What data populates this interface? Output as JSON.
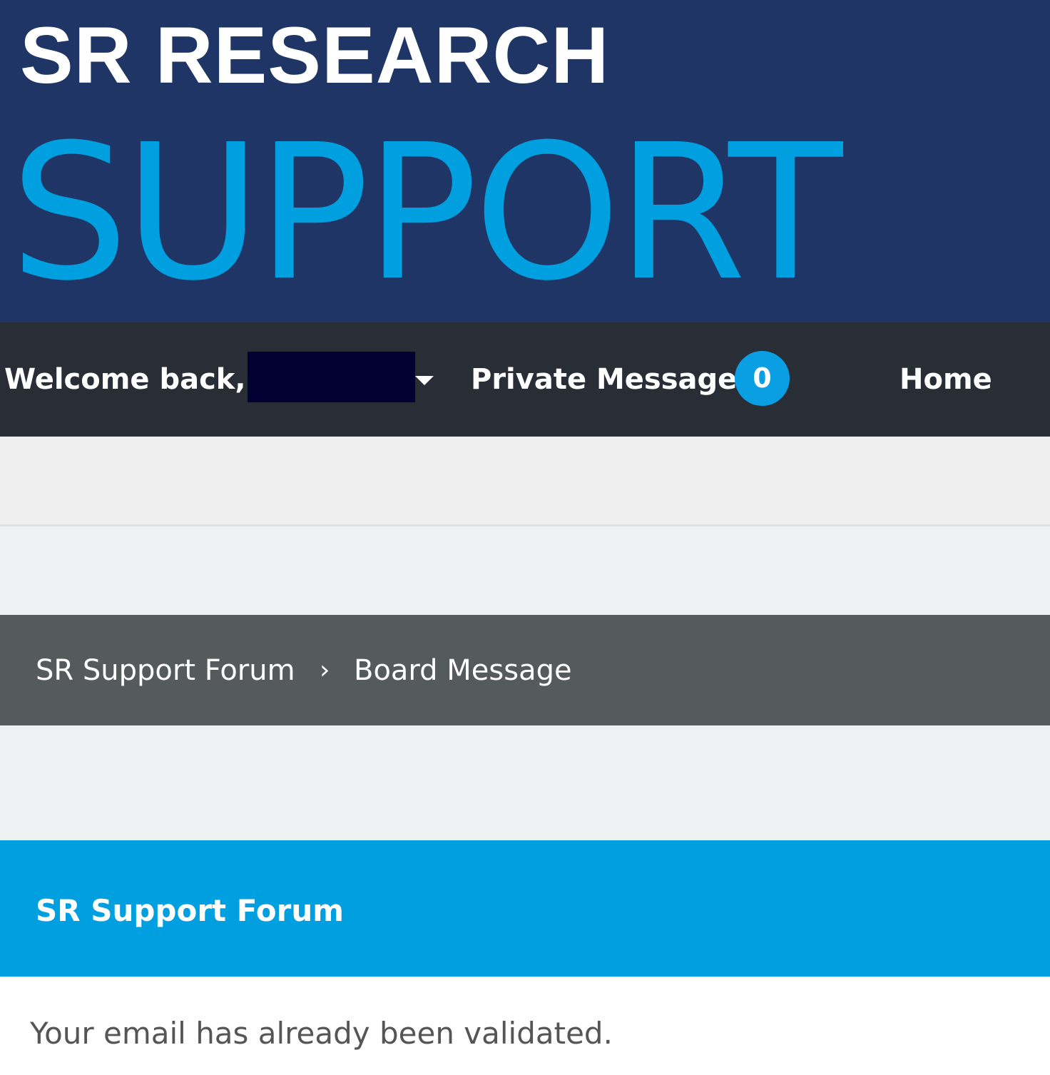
{
  "banner": {
    "logo_line1": "SR RESEARCH",
    "logo_line2": "SUPPORT",
    "colors": {
      "background": "#1e3565",
      "accent": "#009fe0"
    }
  },
  "topnav": {
    "welcome_text": "Welcome back, Q",
    "user_menu_icon": "chevron-down-icon",
    "private_messages_label": "Private Messages",
    "private_messages_count": "0",
    "home_label": "Home",
    "colors": {
      "background": "#292e36",
      "badge": "#0a9ee3"
    }
  },
  "breadcrumb": {
    "items": [
      "SR Support Forum",
      "Board Message"
    ],
    "separator": "›",
    "colors": {
      "background": "#555a5a"
    }
  },
  "panel": {
    "title": "SR Support Forum",
    "message": "Your email has already been validated.",
    "colors": {
      "header": "#009fdf"
    }
  }
}
